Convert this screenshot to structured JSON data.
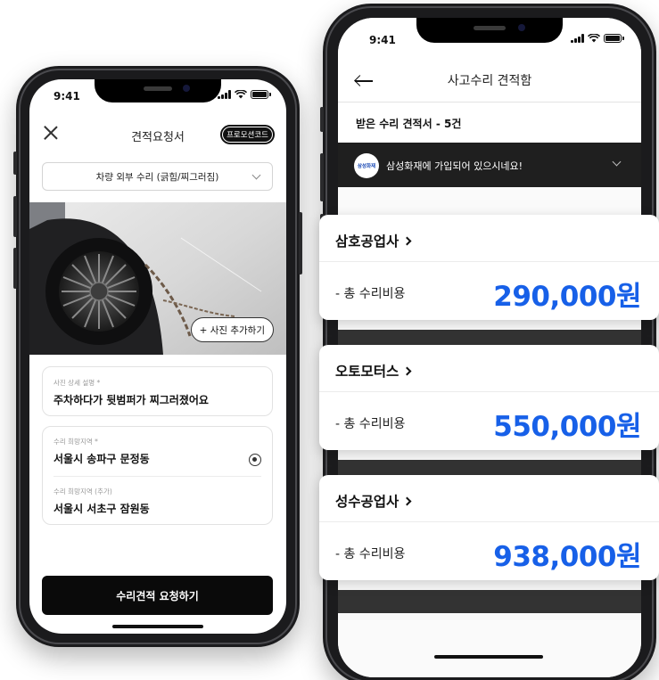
{
  "left": {
    "status_time": "9:41",
    "header": {
      "title": "견적요청서",
      "promo_label": "프로모션코드"
    },
    "service_select": {
      "value": "차량 외부 수리 (긁힘/찌그러짐)"
    },
    "photo": {
      "add_label": "+ 사진 추가하기"
    },
    "detail": {
      "label": "사진 상세 설명 *",
      "value": "주차하다가 뒷범퍼가 찌그러졌어요"
    },
    "region": {
      "label": "수리 희망지역 *",
      "value": "서울시 송파구 문정동",
      "extra_label": "수리 희망지역 (추가)",
      "extra_value": "서울시 서초구 잠원동"
    },
    "submit_label": "수리견적 요청하기"
  },
  "right": {
    "status_time": "9:41",
    "header": {
      "title": "사고수리 견적함"
    },
    "subtitle": "받은 수리 견적서 - 5건",
    "insurance": {
      "logo_text": "삼성화재",
      "text": "삼성화재에 가입되어 있으시네요!"
    },
    "quotes": [
      {
        "shop": "삼호공업사",
        "cost_label": "- 총 수리비용",
        "cost": "290,000원"
      },
      {
        "shop": "오토모터스",
        "cost_label": "- 총 수리비용",
        "cost": "550,000원"
      },
      {
        "shop": "성수공업사",
        "cost_label": "- 총 수리비용",
        "cost": "938,000원"
      }
    ]
  },
  "colors": {
    "accent_blue": "#1760e8",
    "dark_button": "#0a0a0a",
    "banner_dark": "#1f1f1f"
  }
}
